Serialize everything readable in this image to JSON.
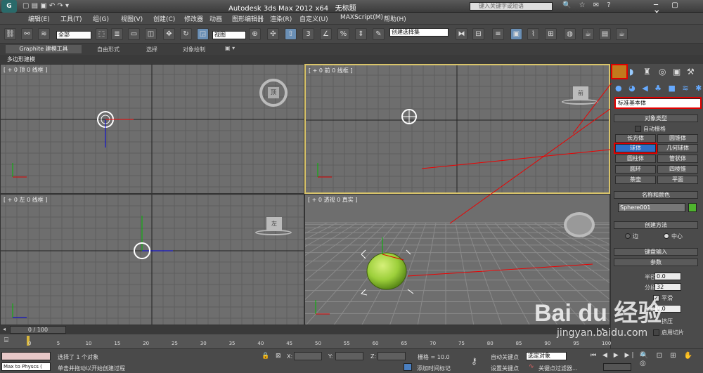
{
  "title": {
    "app": "Autodesk 3ds Max  2012 x64",
    "file": "无标题",
    "search_placeholder": "键入关键字或短语"
  },
  "menu": [
    "编辑(E)",
    "工具(T)",
    "组(G)",
    "视图(V)",
    "创建(C)",
    "修改器",
    "动画",
    "图形编辑器",
    "渲染(R)",
    "自定义(U)",
    "MAXScript(M)",
    "帮助(H)"
  ],
  "toolbar": {
    "selection_filter": "全部",
    "ref_coord": "视图",
    "named_selection": "创建选择集"
  },
  "ribbon": {
    "tabs": [
      "Graphite 建模工具",
      "自由形式",
      "选择",
      "对象绘制"
    ],
    "sub": "多边形建模"
  },
  "viewports": {
    "top": "[ + 0 顶 0 线框 ]",
    "front": "[ + 0 前 0 线框 ]",
    "left": "[ + 0 左 0 线框 ]",
    "persp": "[ + 0 透视 0 真实 ]",
    "cube_top": "顶",
    "cube_front": "前",
    "cube_left": "左"
  },
  "cmd": {
    "category": "标准基本体",
    "object_type": "对象类型",
    "autogrid": "自动栅格",
    "buttons": [
      "长方体",
      "圆锥体",
      "球体",
      "几何球体",
      "圆柱体",
      "管状体",
      "圆环",
      "四棱锥",
      "茶壶",
      "平面"
    ],
    "name_color": "名称和颜色",
    "object_name": "Sphere001",
    "object_color": "#4fb52e",
    "creation_method": "创建方法",
    "edge": "边",
    "center": "中心",
    "keyboard": "键盘输入",
    "params": "参数",
    "radius_label": "半径:",
    "radius": "0.0",
    "segments_label": "分段:",
    "segments": "32",
    "smooth": "平滑",
    "hemisphere_label": "半球:",
    "hemisphere": "0.0",
    "squash": "挤压",
    "slice_on": "启用切片"
  },
  "timeline": {
    "frame": "0 / 100",
    "ticks": [
      "0",
      "5",
      "10",
      "15",
      "20",
      "25",
      "30",
      "35",
      "40",
      "45",
      "50",
      "55",
      "60",
      "65",
      "70",
      "75",
      "80",
      "85",
      "90",
      "95",
      "100"
    ]
  },
  "status": {
    "script_listener": "Max to Physcs (",
    "selected": "选择了 1 个对象",
    "prompt": "单击并拖动以开始创建过程",
    "x": "X:",
    "y": "Y:",
    "z": "Z:",
    "grid": "栅格 = 10.0",
    "add_time_tag": "添加时间标记",
    "auto_key": "自动关键点",
    "set_key": "设置关键点",
    "selected_obj": "选定对象",
    "key_filters": "关键点过滤器..."
  },
  "watermark": {
    "brand": "Bai du 经验",
    "url": "jingyan.baidu.com"
  }
}
